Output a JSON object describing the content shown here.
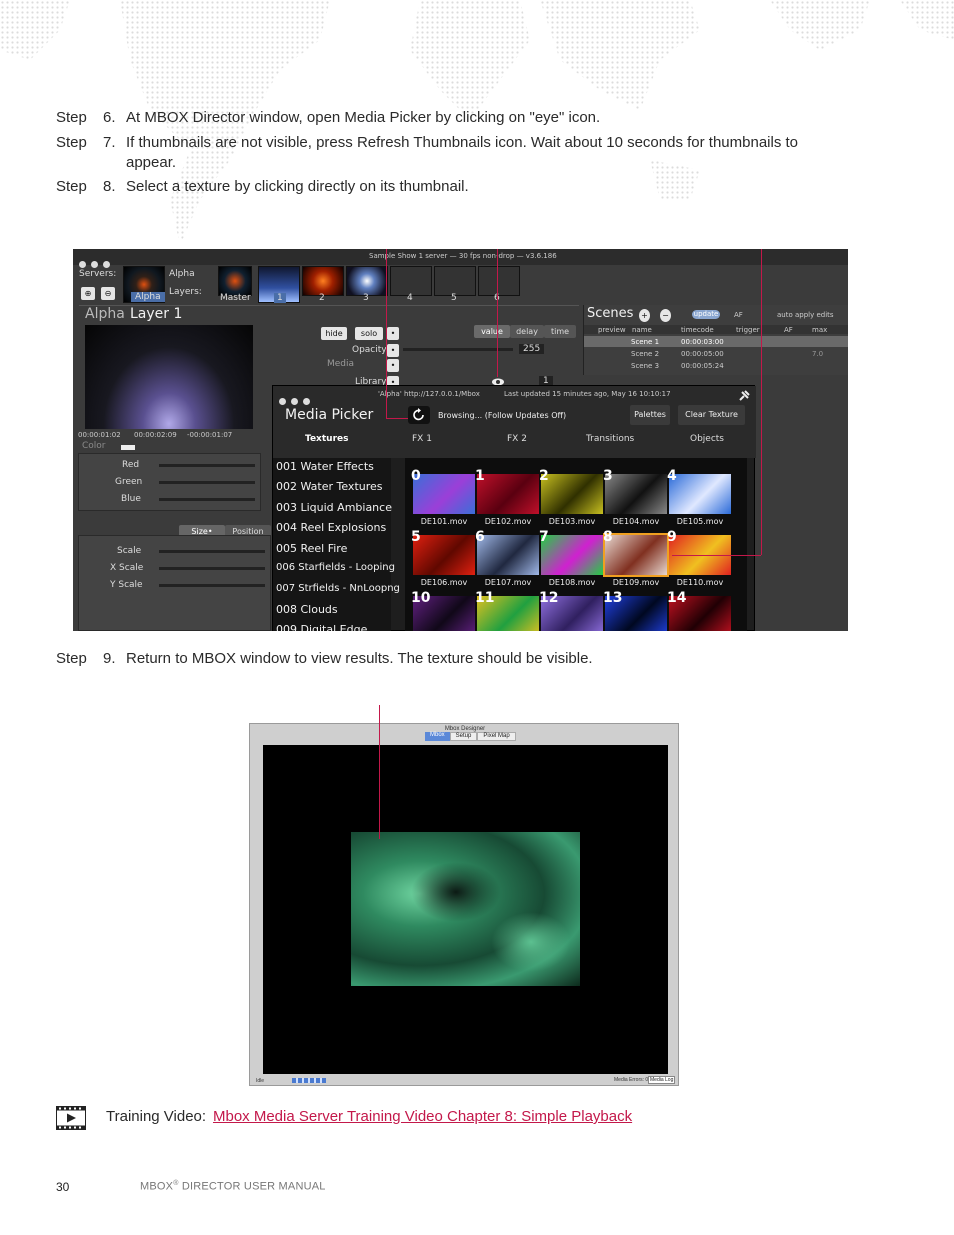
{
  "steps": [
    {
      "label": "Step",
      "number": "6.",
      "text": "At MBOX Director window, open Media Picker by clicking on \"eye\" icon."
    },
    {
      "label": "Step",
      "number": "7.",
      "text": "If thumbnails are not visible, press Refresh Thumbnails icon. Wait about 10 seconds for thumbnails to appear."
    },
    {
      "label": "Step",
      "number": "8.",
      "text": "Select a texture by clicking directly on its thumbnail."
    },
    {
      "label": "Step",
      "number": "9.",
      "text": "Return to MBOX window to view results. The texture should be visible."
    }
  ],
  "director": {
    "window_title": "Sample Show 1 server  —  30 fps non-drop  —  v3.6.186",
    "servers_label": "Servers:",
    "server_name": "Alpha",
    "server_tab": "Alpha",
    "layers_label": "Layers:",
    "master_label": "Master",
    "layer_numbers": [
      "1",
      "2",
      "3",
      "4",
      "5",
      "6"
    ],
    "layer_title_prefix": "Alpha",
    "layer_title": "Layer 1",
    "hide": "hide",
    "solo": "solo",
    "value": "value",
    "delay": "delay",
    "time": "time",
    "opacity": "Opacity",
    "opacity_value": "255",
    "media": "Media",
    "library": "Library",
    "library_value": "1",
    "timecodes": [
      "00:00:01:02",
      "00:00:02:09",
      "-00:00:01:07"
    ],
    "color": "Color",
    "red": "Red",
    "green": "Green",
    "blue": "Blue",
    "size_tab": "Size•",
    "position_tab": "Position",
    "scale": "Scale",
    "x_scale": "X Scale",
    "y_scale": "Y Scale",
    "scenes": {
      "title": "Scenes",
      "update": "update",
      "af": "AF",
      "auto_apply": "auto apply edits",
      "columns": [
        "preview",
        "name",
        "timecode",
        "trigger",
        "AF",
        "max"
      ],
      "rows": [
        {
          "name": "Scene 1",
          "timecode": "00:00:03:00",
          "max": ""
        },
        {
          "name": "Scene 2",
          "timecode": "00:00:05:00",
          "max": "7.0"
        },
        {
          "name": "Scene 3",
          "timecode": "00:00:05:24",
          "max": ""
        }
      ]
    },
    "media_picker": {
      "url": "'Alpha' http://127.0.0.1/Mbox",
      "updated": "Last updated 15 minutes ago, May 16 10:10:17",
      "title": "Media Picker",
      "browsing": "Browsing... (Follow Updates Off)",
      "palettes": "Palettes",
      "clear_texture": "Clear Texture",
      "tabs": [
        "Textures",
        "FX 1",
        "FX 2",
        "Transitions",
        "Objects"
      ],
      "list": [
        "001 Water Effects",
        "002 Water Textures",
        "003 Liquid Ambiance",
        "004 Reel Explosions",
        "005 Reel Fire",
        "006 Starfields - Looping",
        "007 Strfields - NnLoopng",
        "008 Clouds",
        "009 Digital Edge"
      ],
      "thumbs": [
        {
          "n": "0",
          "file": "DE101.mov",
          "c1": "#3a6fd8",
          "c2": "#9b3fd8"
        },
        {
          "n": "1",
          "file": "DE102.mov",
          "c1": "#c0102a",
          "c2": "#5a0010"
        },
        {
          "n": "2",
          "file": "DE103.mov",
          "c1": "#c8c020",
          "c2": "#303000"
        },
        {
          "n": "3",
          "file": "DE104.mov",
          "c1": "#888888",
          "c2": "#111111"
        },
        {
          "n": "4",
          "file": "DE105.mov",
          "c1": "#2a6ad8",
          "c2": "#e0e8ff"
        },
        {
          "n": "5",
          "file": "DE106.mov",
          "c1": "#e02010",
          "c2": "#600800"
        },
        {
          "n": "6",
          "file": "DE107.mov",
          "c1": "#a0b8e8",
          "c2": "#202840"
        },
        {
          "n": "7",
          "file": "DE108.mov",
          "c1": "#20d040",
          "c2": "#d020d0"
        },
        {
          "n": "8",
          "file": "DE109.mov",
          "c1": "#e8d8d0",
          "c2": "#803020"
        },
        {
          "n": "9",
          "file": "DE110.mov",
          "c1": "#e02020",
          "c2": "#f0c020"
        },
        {
          "n": "10",
          "file": "",
          "c1": "#602080",
          "c2": "#100818"
        },
        {
          "n": "11",
          "file": "",
          "c1": "#e0c020",
          "c2": "#20a040"
        },
        {
          "n": "12",
          "file": "",
          "c1": "#9070e0",
          "c2": "#302060"
        },
        {
          "n": "13",
          "file": "",
          "c1": "#2040e0",
          "c2": "#000820"
        },
        {
          "n": "14",
          "file": "",
          "c1": "#c01020",
          "c2": "#200004"
        }
      ]
    }
  },
  "mbox": {
    "title": "Mbox Designer",
    "tabs": [
      "Mbox",
      "Setup",
      "Pixel Map"
    ],
    "status_left": "Idle",
    "status_right": "Media Errors: 0",
    "media_log": "Media Log"
  },
  "training": {
    "label": "Training Video:",
    "link": "Mbox Media Server Training Video Chapter 8: Simple Playback"
  },
  "footer": {
    "page": "30",
    "title": "MBOX",
    "reg": "®",
    "title_rest": " DIRECTOR USER MANUAL"
  },
  "colors": {
    "accent": "#c3184a",
    "texture": "#3aa070"
  }
}
